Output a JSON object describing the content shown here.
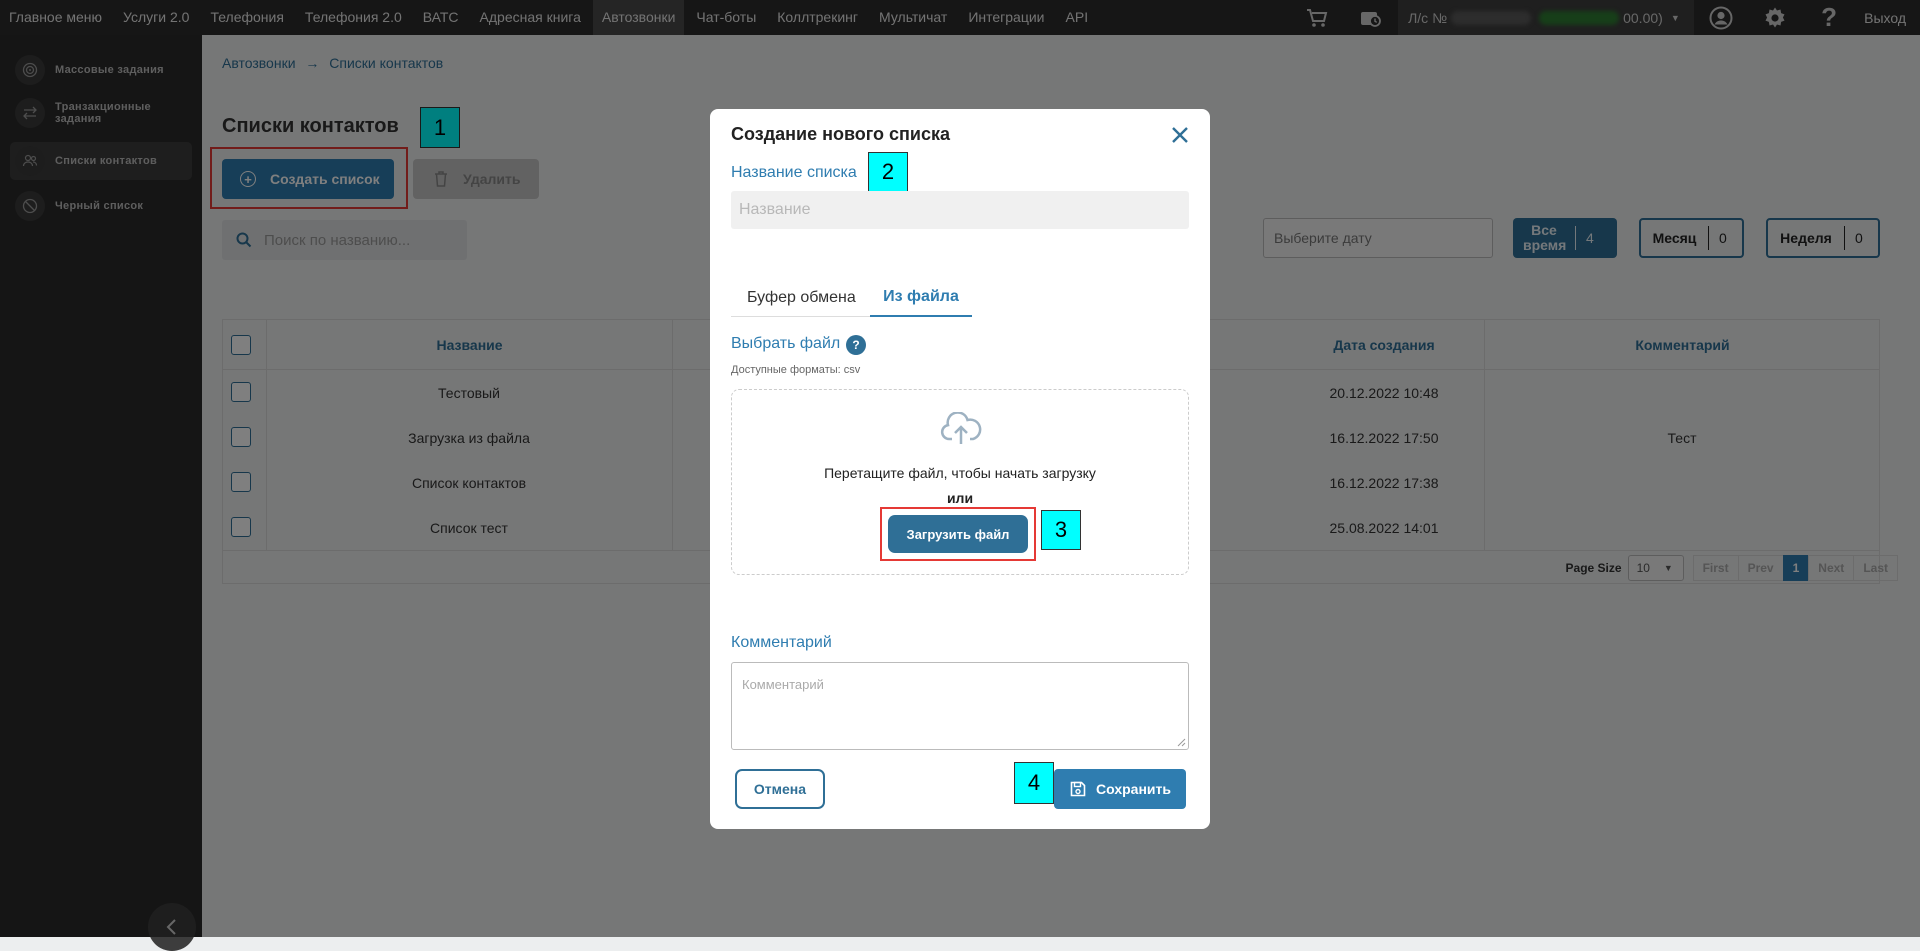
{
  "topnav": {
    "items": [
      {
        "label": "Главное меню"
      },
      {
        "label": "Услуги 2.0"
      },
      {
        "label": "Телефония"
      },
      {
        "label": "Телефония 2.0"
      },
      {
        "label": "ВАТС"
      },
      {
        "label": "Адресная книга"
      },
      {
        "label": "Автозвонки",
        "active": true
      },
      {
        "label": "Чат-боты"
      },
      {
        "label": "Коллтрекинг"
      },
      {
        "label": "Мультичат"
      },
      {
        "label": "Интеграции"
      },
      {
        "label": "API"
      }
    ],
    "account_prefix": "Л/с №",
    "account_suffix": "00.00)",
    "logout": "Выход"
  },
  "sidebar": {
    "items": [
      {
        "label": "Массовые задания",
        "icon": "target-icon"
      },
      {
        "label": "Транзакционные задания",
        "icon": "arrows-icon"
      },
      {
        "label": "Списки контактов",
        "icon": "users-icon",
        "active": true
      },
      {
        "label": "Черный список",
        "icon": "block-icon"
      }
    ]
  },
  "breadcrumb": {
    "part1": "Автозвонки",
    "sep": "→",
    "part2": "Списки контактов"
  },
  "page": {
    "title": "Списки контактов",
    "create_label": "Создать список",
    "delete_label": "Удалить",
    "search_placeholder": "Поиск по названию..."
  },
  "filters": {
    "date_placeholder": "Выберите дату",
    "all_time_label": "Все время",
    "all_time_count": "4",
    "month_label": "Месяц",
    "month_count": "0",
    "week_label": "Неделя",
    "week_count": "0"
  },
  "table": {
    "headers": {
      "name": "Название",
      "date": "Дата создания",
      "comment": "Комментарий"
    },
    "rows": [
      {
        "name": "Тестовый",
        "date": "20.12.2022 10:48",
        "comment": ""
      },
      {
        "name": "Загрузка из файла",
        "date": "16.12.2022 17:50",
        "comment": "Тест"
      },
      {
        "name": "Список контактов",
        "date": "16.12.2022 17:38",
        "comment": ""
      },
      {
        "name": "Список тест",
        "date": "25.08.2022 14:01",
        "comment": ""
      }
    ]
  },
  "pager": {
    "page_size_label": "Page Size",
    "page_size": "10",
    "first": "First",
    "prev": "Prev",
    "current": "1",
    "next": "Next",
    "last": "Last"
  },
  "modal": {
    "title": "Создание нового списка",
    "name_label": "Название списка",
    "name_placeholder": "Название",
    "tab_clipboard": "Буфер обмена",
    "tab_file": "Из файла",
    "choose_file": "Выбрать файл",
    "help": "?",
    "formats": "Доступные форматы: csv",
    "drop_text": "Перетащите файл, чтобы начать загрузку",
    "or": "или",
    "upload_label": "Загрузить файл",
    "comment_label": "Комментарий",
    "comment_placeholder": "Комментарий",
    "cancel": "Отмена",
    "save": "Сохранить"
  },
  "callouts": {
    "n1": "1",
    "n2": "2",
    "n3": "3",
    "n4": "4"
  },
  "colors": {
    "accent": "#2f7db0",
    "highlight": "#e53935",
    "callout": "#00ffff"
  }
}
